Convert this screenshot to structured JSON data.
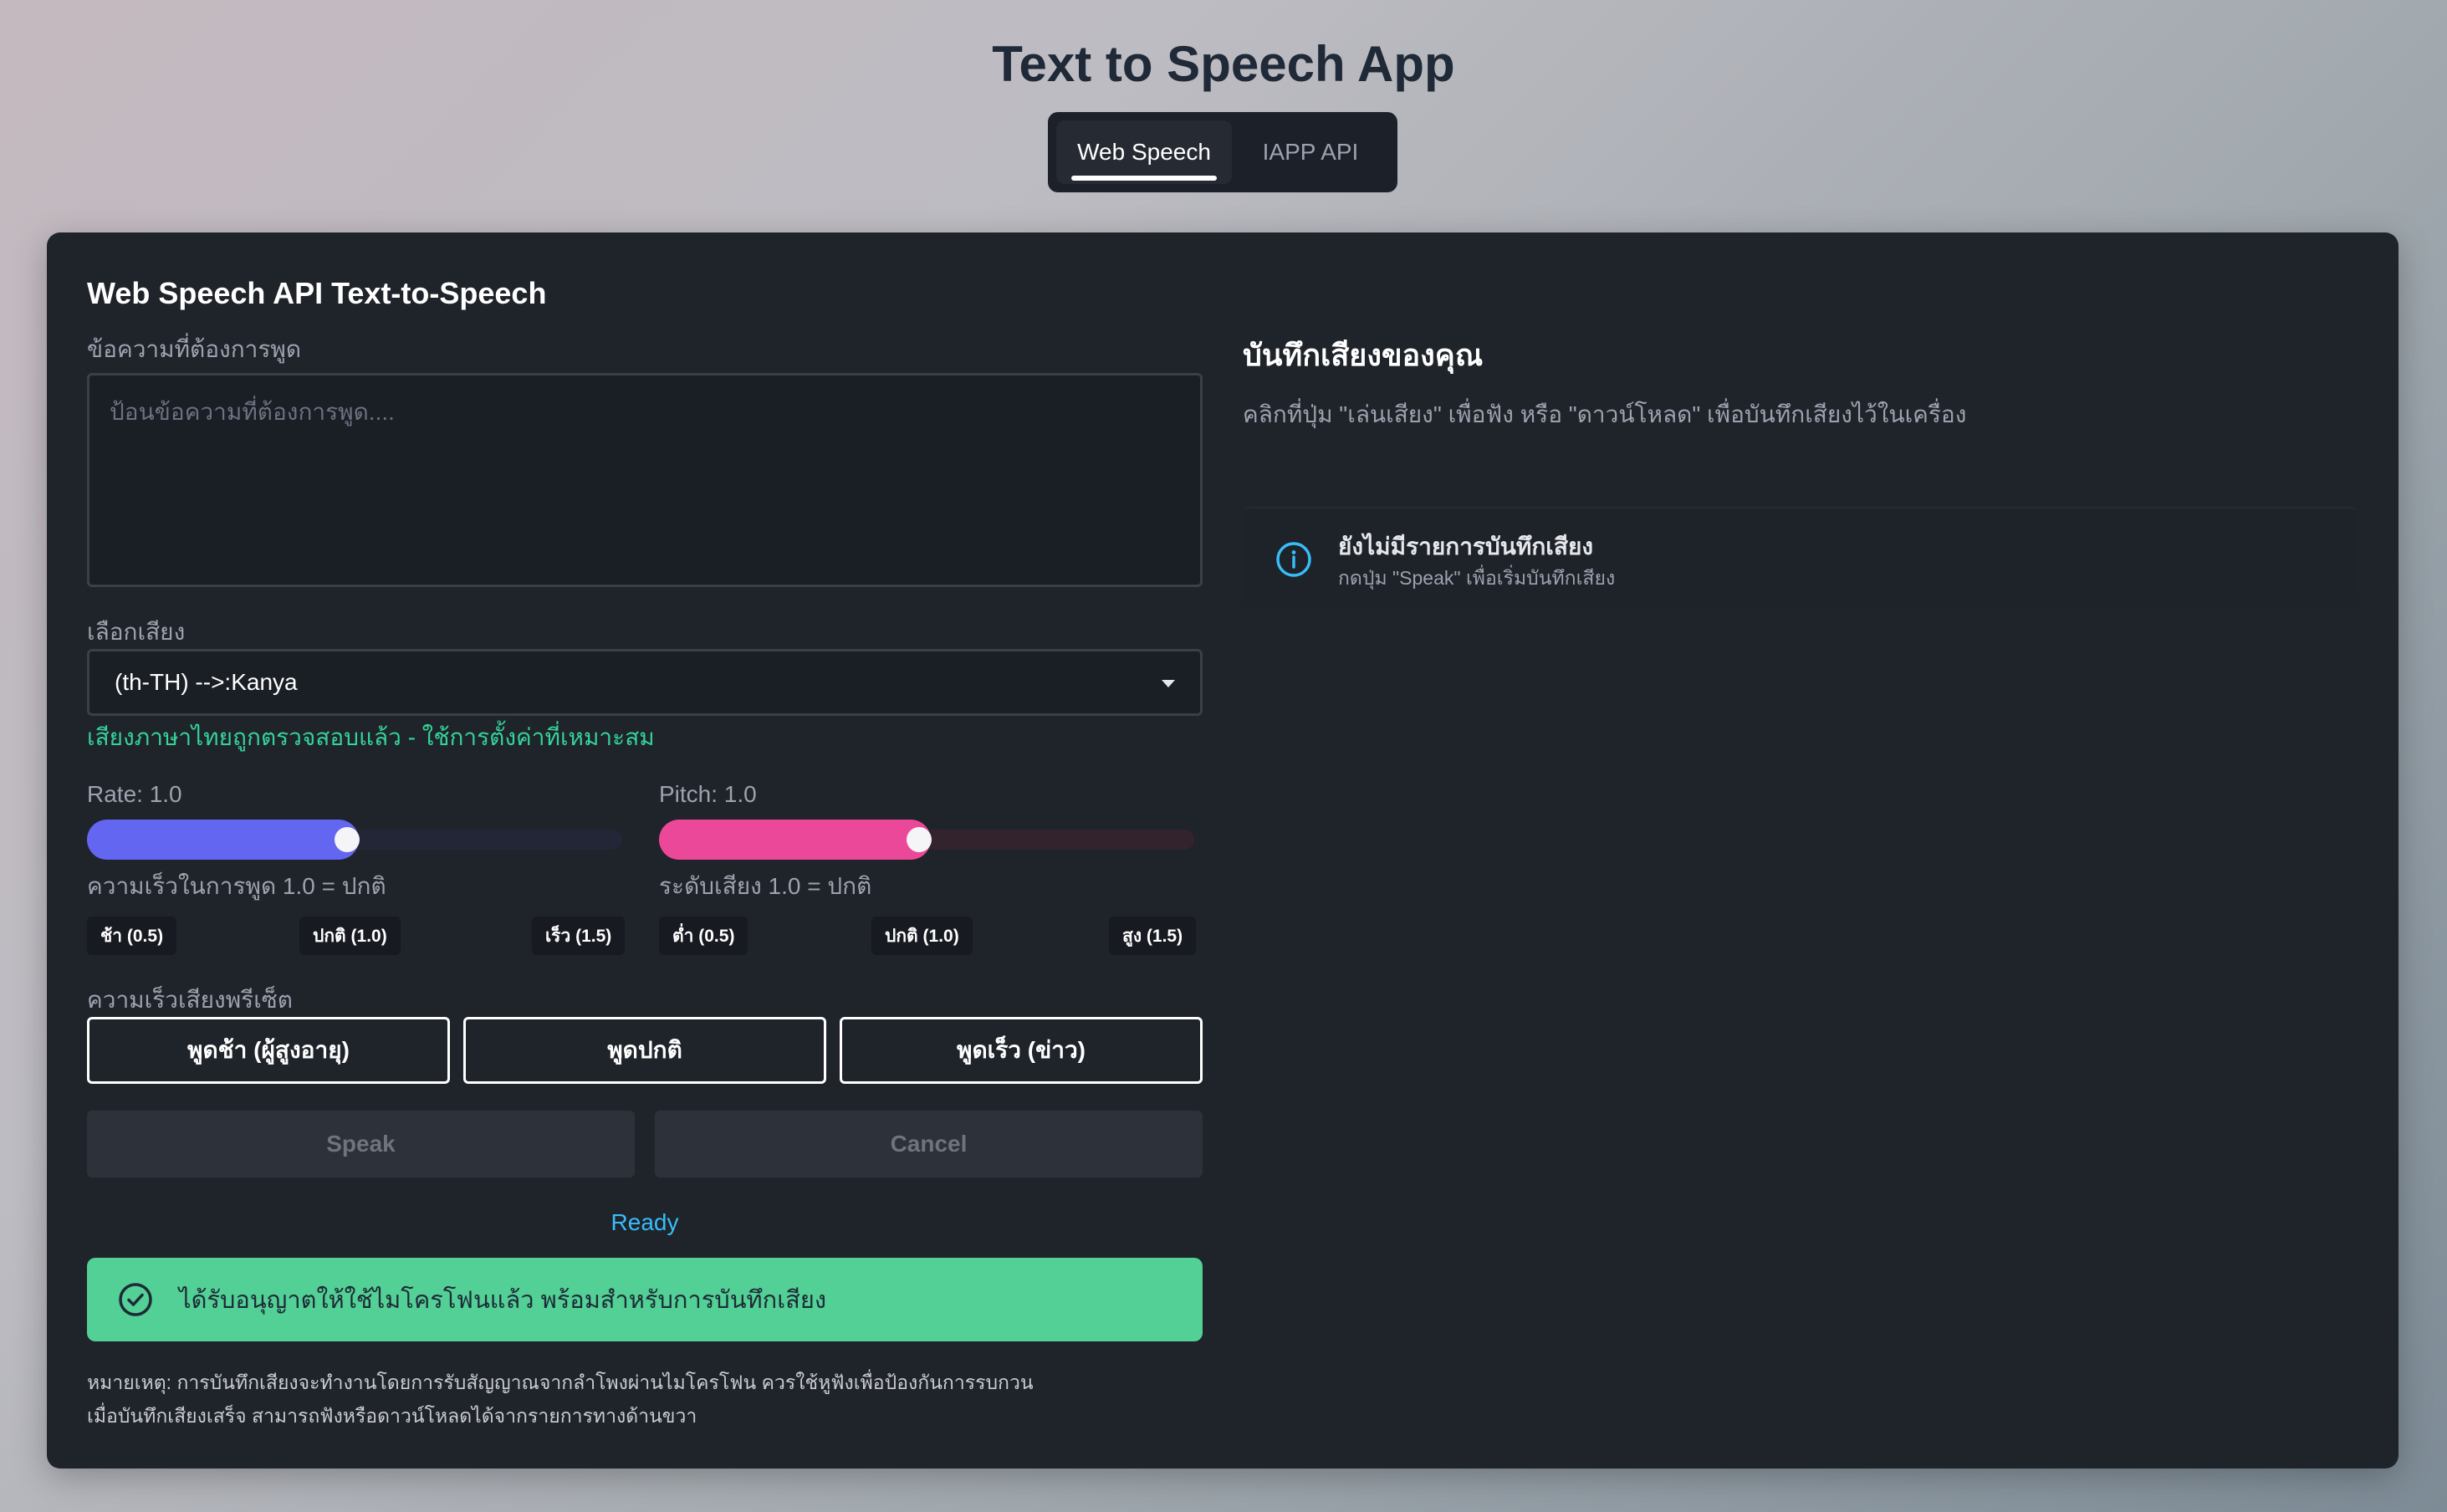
{
  "app": {
    "title": "Text to Speech App"
  },
  "tabs": [
    {
      "label": "Web Speech",
      "active": true
    },
    {
      "label": "IAPP API",
      "active": false
    }
  ],
  "panel": {
    "title": "Web Speech API Text-to-Speech"
  },
  "text_input": {
    "label": "ข้อความที่ต้องการพูด",
    "placeholder": "ป้อนข้อความที่ต้องการพูด....",
    "value": ""
  },
  "voice": {
    "label": "เลือกเสียง",
    "selected": "(th-TH) -->:Kanya",
    "status": "เสียงภาษาไทยถูกตรวจสอบแล้ว - ใช้การตั้งค่าที่เหมาะสม"
  },
  "rate": {
    "label": "Rate: 1.0",
    "fraction": 0.47,
    "hint": "ความเร็วในการพูด  1.0 = ปกติ",
    "ticks": [
      "ช้า (0.5)",
      "ปกติ (1.0)",
      "เร็ว (1.5)"
    ],
    "color": "#6366f1"
  },
  "pitch": {
    "label": "Pitch: 1.0",
    "fraction": 0.47,
    "hint": "ระดับเสียง  1.0 = ปกติ",
    "ticks": [
      "ต่ำ (0.5)",
      "ปกติ (1.0)",
      "สูง (1.5)"
    ],
    "color": "#ec4899"
  },
  "presets": {
    "label": "ความเร็วเสียงพรีเซ็ต",
    "items": [
      "พูดช้า (ผู้สูงอายุ)",
      "พูดปกติ",
      "พูดเร็ว (ข่าว)"
    ]
  },
  "actions": {
    "speak": "Speak",
    "cancel": "Cancel"
  },
  "status": "Ready",
  "alert": {
    "text": "ได้รับอนุญาตให้ใช้ไมโครโฟนแล้ว พร้อมสำหรับการบันทึกเสียง",
    "icon": "check-circle-icon"
  },
  "notes": [
    "หมายเหตุ: การบันทึกเสียงจะทำงานโดยการรับสัญญาณจากลำโพงผ่านไมโครโฟน ควรใช้หูฟังเพื่อป้องกันการรบกวน",
    "เมื่อบันทึกเสียงเสร็จ สามารถฟังหรือดาวน์โหลดได้จากรายการทางด้านขวา"
  ],
  "recordings": {
    "title": "บันทึกเสียงของคุณ",
    "description": "คลิกที่ปุ่ม \"เล่นเสียง\" เพื่อฟัง หรือ \"ดาวน์โหลด\" เพื่อบันทึกเสียงไว้ในเครื่อง",
    "empty_title": "ยังไม่มีรายการบันทึกเสียง",
    "empty_subtitle": "กดปุ่ม \"Speak\" เพื่อเริ่มบันทึกเสียง",
    "empty_icon": "info-icon"
  }
}
